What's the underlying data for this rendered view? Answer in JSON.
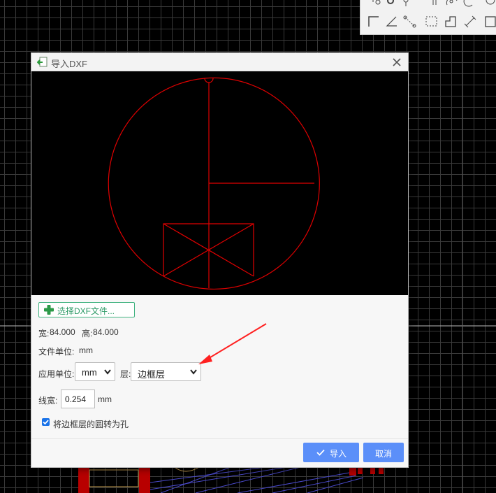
{
  "dialog": {
    "title": "导入DXF",
    "select_button_label": "选择DXF文件...",
    "width_label": "宽:",
    "width_value": "84.000",
    "height_label": "高:",
    "height_value": "84.000",
    "file_unit_label": "文件单位:",
    "file_unit_value": "mm",
    "apply_unit_label": "应用单位:",
    "apply_unit_value": "mm",
    "layer_label": "层:",
    "layer_value": "边框层",
    "line_width_label": "线宽:",
    "line_width_value": "0.254",
    "line_width_unit": "mm",
    "checkbox_label": "将边框层的圆转为孔",
    "checkbox_checked": true,
    "import_label": "导入",
    "cancel_label": "取消"
  },
  "colors": {
    "accent_button": "#5b8ff9",
    "preview_stroke": "#e00000",
    "annotation_arrow": "#ff2020",
    "select_button_text": "#2c9a66"
  },
  "icons": [
    "import-dxf-icon",
    "close-icon",
    "plus-icon",
    "chevron-down-icon",
    "checkmark-icon",
    "corner-tool-icon",
    "angle-tool-icon",
    "dimension-tool-icon",
    "rect-tool-icon"
  ]
}
